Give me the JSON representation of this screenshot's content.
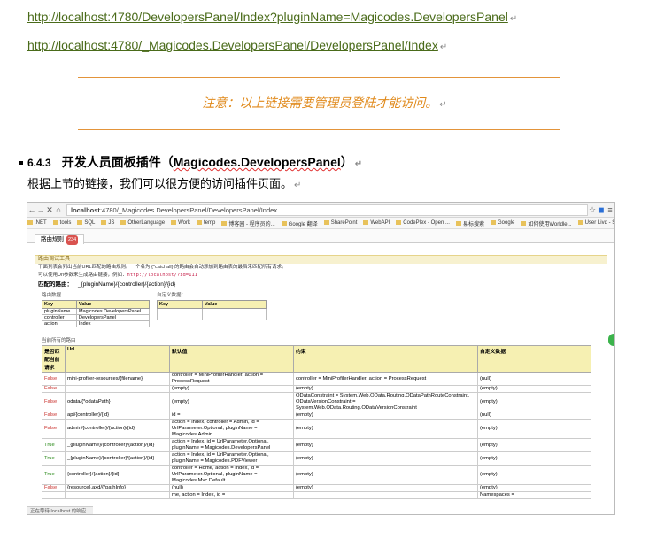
{
  "links": [
    "http://localhost:4780/DevelopersPanel/Index?pluginName=Magicodes.DevelopersPanel",
    "http://localhost:4780/_Magicodes.DevelopersPanel/DevelopersPanel/Index"
  ],
  "notice": "注意：以上链接需要管理员登陆才能访问。",
  "section": {
    "number": "6.4.3",
    "title_prefix": "开发人员面板插件（",
    "title_name": "Magicodes.DevelopersPanel",
    "title_suffix": "）"
  },
  "paragraph": "根据上节的链接，我们可以很方便的访问插件页面。",
  "paragraph_mark": "↵",
  "screenshot": {
    "url_host": "localhost",
    "url_path": ":4780/_Magicodes.DevelopersPanel/DevelopersPanel/Index",
    "bookmarks": [
      ".NET",
      "tools",
      "SQL",
      "JS",
      "OtherLanguage",
      "Work",
      "temp",
      "博客园 - 程序员的...",
      "Google 翻译",
      "SharePoint",
      "WebAPI",
      "CodePlex - Open ...",
      "易标搜索",
      "Google",
      "如何使用Worldle...",
      "User Livq - Stack ..."
    ],
    "tab_label": "路由规则",
    "tab_badge": "234",
    "panel_title": "路由调试工具",
    "desc_line": "下面列表会列出当前URL匹配的路由规则。一个名为 {*catchall} 的路由会自动添加到路由表的最后来匹配所有请求。",
    "desc_line2": "可以使用Url参数来生成路由链接，例如：",
    "desc_code": "http://localhost/?id=111",
    "matched_label": "匹配的路由：",
    "matched_value": "_{pluginName}/{controller}/{action}/{id}",
    "route_data_caption": "路由数据",
    "custom_data_caption": "自定义数据：",
    "kv_headers": [
      "Key",
      "Value"
    ],
    "route_data": [
      [
        "pluginName",
        "Magicodes.DevelopersPanel"
      ],
      [
        "controller",
        "DevelopersPanel"
      ],
      [
        "action",
        "Index"
      ]
    ],
    "routes_caption": "当前所有的路由",
    "routes_headers": [
      "是否匹配当前请求",
      "Url",
      "默认值",
      "约束",
      "自定义数据"
    ],
    "routes": [
      [
        "False",
        "mini-profiler-resources/{filename}",
        "controller = MiniProfilerHandler, action = ProcessRequest",
        "controller = MiniProfilerHandler, action = ProcessRequest",
        "(null)"
      ],
      [
        "False",
        "",
        "(empty)",
        "(empty)",
        "(empty)"
      ],
      [
        "False",
        "odata/{*odataPath}",
        "(empty)",
        "ODataConstraint = System.Web.OData.Routing.ODataPathRouteConstraint, ODataVersionConstraint = System.Web.OData.Routing.ODataVersionConstraint",
        "(empty)"
      ],
      [
        "False",
        "api/{controller}/{id}",
        "id =",
        "(empty)",
        "(null)"
      ],
      [
        "False",
        "admin/{controller}/{action}/{id}",
        "action = Index, controller = Admin, id = UrlParameter.Optional, pluginName = Magicodes.Admin",
        "(empty)",
        "(empty)"
      ],
      [
        "True",
        "_{pluginName}/{controller}/{action}/{id}",
        "action = Index, id = UrlParameter.Optional, pluginName = Magicodes.DevelopersPanel",
        "(empty)",
        "(empty)"
      ],
      [
        "True",
        "_{pluginName}/{controller}/{action}/{id}",
        "action = Index, id = UrlParameter.Optional, pluginName = Magicodes.PDFViewer",
        "(empty)",
        "(empty)"
      ],
      [
        "True",
        "{controller}/{action}/{id}",
        "controller = Home, action = Index, id = UrlParameter.Optional, pluginName = Magicodes.Mvc.Default",
        "(empty)",
        "(empty)"
      ],
      [
        "False",
        "{resource}.axd/{*pathInfo}",
        "(null)",
        "(empty)",
        "(empty)"
      ]
    ],
    "partial_row": [
      "me, action = Index, id =",
      "Namespaces ="
    ],
    "status_text": "正在等待 localhost 的响应..."
  }
}
